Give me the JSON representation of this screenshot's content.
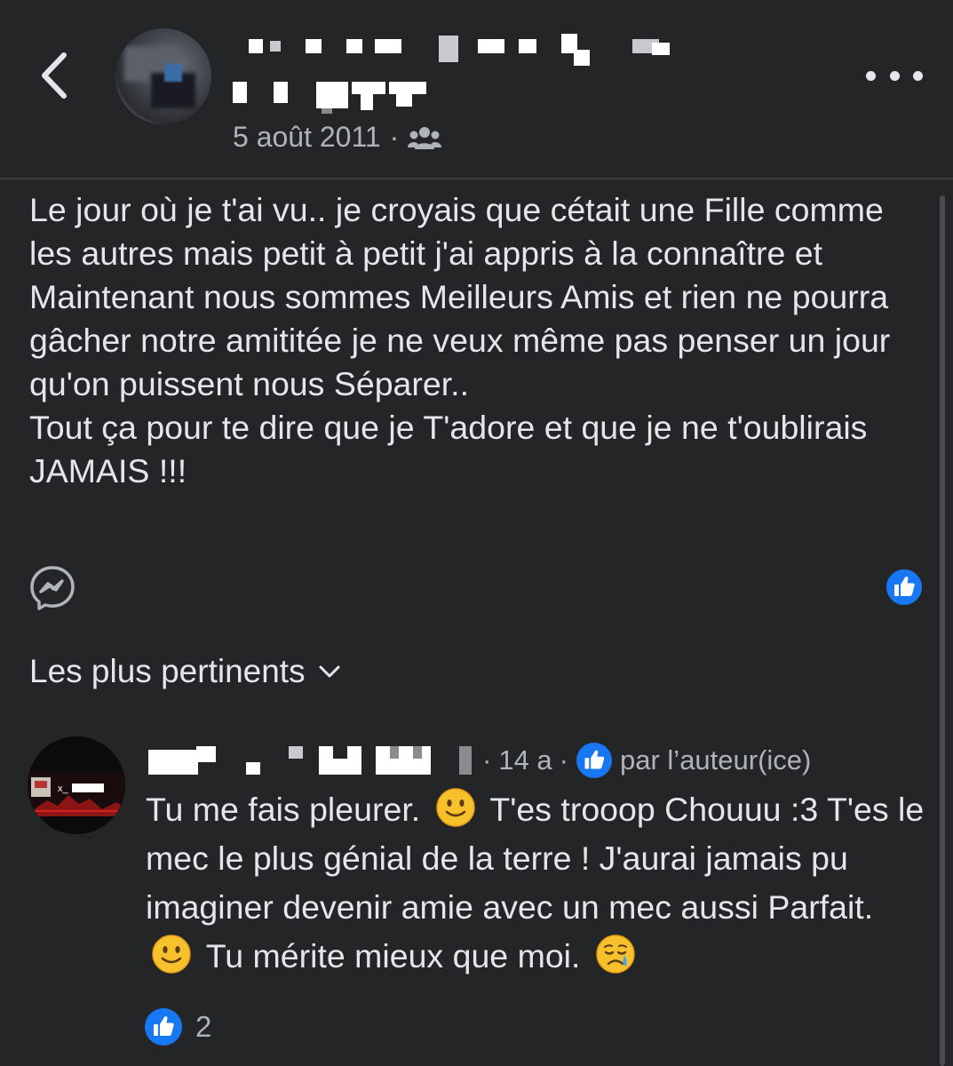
{
  "colors": {
    "background": "#242526",
    "text_primary": "#e4e6eb",
    "text_secondary": "#b0b3b8",
    "like_blue": "#1877f2",
    "divider": "#3e4042"
  },
  "header": {
    "back_icon": "chevron-left-icon",
    "date": "5 août 2011",
    "separator": "·",
    "audience_icon": "friends-icon",
    "more_icon": "more-horizontal-icon"
  },
  "post": {
    "text": "Le jour où je t'ai vu.. je croyais que cétait une Fille comme les autres mais petit à petit j'ai appris à la connaître et Maintenant nous sommes Meilleurs Amis et rien ne pourra gâcher notre amititée je ne veux même pas penser un jour qu'on puissent nous Séparer..\nTout ça pour te dire que je T'adore et que je ne t'oublirais JAMAIS !!!",
    "share_icon": "messenger-icon",
    "reaction_icon": "like-icon"
  },
  "comments_section": {
    "sort_label": "Les plus pertinents",
    "sort_icon": "chevron-down-icon"
  },
  "comment": {
    "age": "14 a",
    "separator": "·",
    "liked_by_label": "par l’auteur(ice)",
    "text_parts": [
      "Tu me fais pleurer.",
      "T'es trooop Chouuu :3 T'es le mec le plus génial de la terre ! J'aurai jamais pu imaginer devenir amie avec un mec aussi Parfait.",
      "Tu mérite mieux que moi."
    ],
    "reaction_count": "2"
  }
}
